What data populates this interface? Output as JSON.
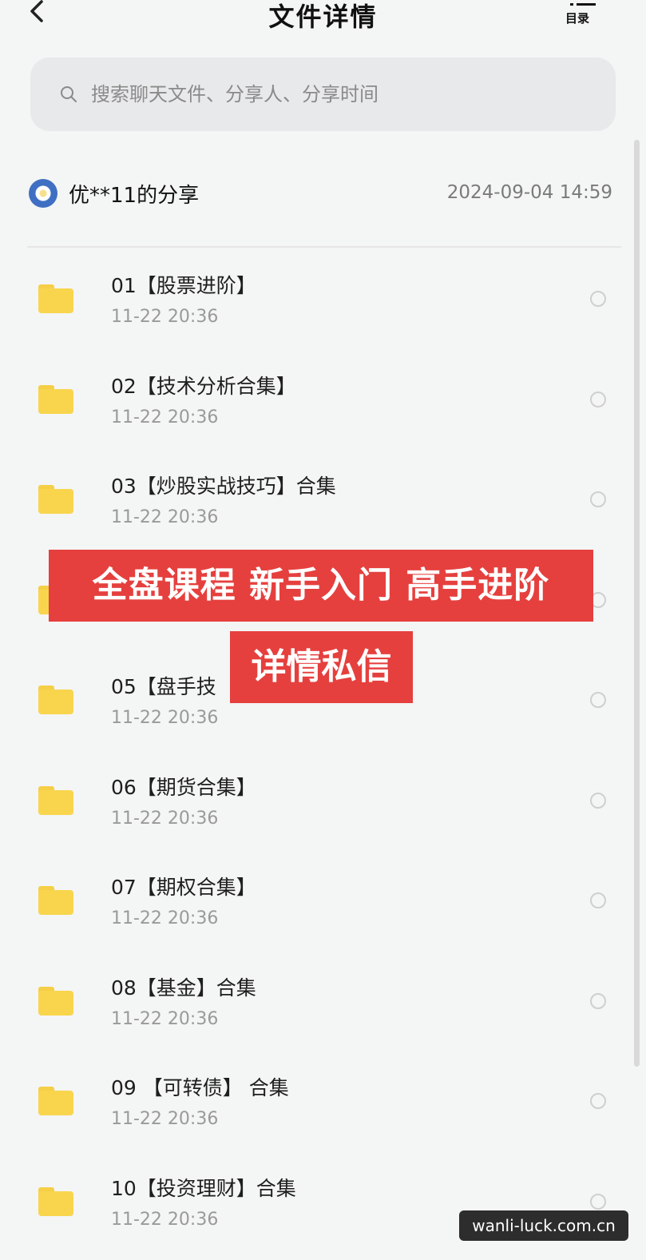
{
  "header": {
    "title": "文件详情",
    "toc_label": "目录"
  },
  "search": {
    "placeholder": "搜索聊天文件、分享人、分享时间"
  },
  "share": {
    "sharer": "优**11的分享",
    "time": "2024-09-04  14:59"
  },
  "files": [
    {
      "name": "01【股票进阶】",
      "time": "11-22  20:36"
    },
    {
      "name": "02【技术分析合集】",
      "time": "11-22  20:36"
    },
    {
      "name": "03【炒股实战技巧】合集",
      "time": "11-22  20:36"
    },
    {
      "name": "",
      "time": ""
    },
    {
      "name": "05【盘手技",
      "time": "11-22  20:36"
    },
    {
      "name": "06【期货合集】",
      "time": "11-22  20:36"
    },
    {
      "name": "07【期权合集】",
      "time": "11-22  20:36"
    },
    {
      "name": "08【基金】合集",
      "time": "11-22  20:36"
    },
    {
      "name": "09 【可转债】 合集",
      "time": "11-22  20:36"
    },
    {
      "name": "10【投资理财】合集",
      "time": "11-22  20:36"
    }
  ],
  "overlay": {
    "banner": "全盘课程  新手入门  高手进阶",
    "sub": "详情私信",
    "color": "#e5403e"
  },
  "watermark": "wanli-luck.com.cn",
  "colors": {
    "background": "#f4f5f5",
    "folder": "#f8d54d"
  }
}
